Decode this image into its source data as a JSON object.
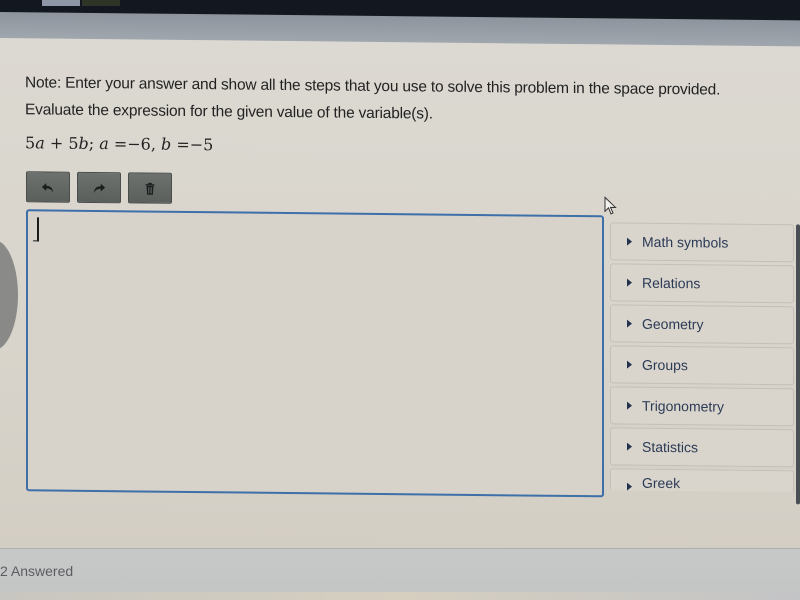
{
  "question": {
    "note": "Note: Enter your answer and show all the steps that you use to solve this problem in the space provided.",
    "instruction": "Evaluate the expression for the given value of the variable(s).",
    "expression": {
      "part1": "5",
      "var_a": "a",
      "part2": " + 5",
      "var_b": "b",
      "part3": "; ",
      "var_a2": "a",
      "part4": " =−6, ",
      "var_b2": "b",
      "part5": " =−5"
    }
  },
  "toolbar": {
    "buttons": [
      {
        "name": "undo",
        "icon": "undo-icon"
      },
      {
        "name": "redo",
        "icon": "redo-icon"
      },
      {
        "name": "clear",
        "icon": "trash-icon"
      }
    ]
  },
  "editor": {
    "value": ""
  },
  "palette": {
    "items": [
      {
        "label": "Math symbols"
      },
      {
        "label": "Relations"
      },
      {
        "label": "Geometry"
      },
      {
        "label": "Groups"
      },
      {
        "label": "Trigonometry"
      },
      {
        "label": "Statistics"
      },
      {
        "label": "Greek"
      }
    ]
  },
  "footer": {
    "status": "2 Answered"
  },
  "colors": {
    "editor_border": "#3d6fa8",
    "palette_text": "#2b3a55",
    "button_bg": "#636764"
  }
}
